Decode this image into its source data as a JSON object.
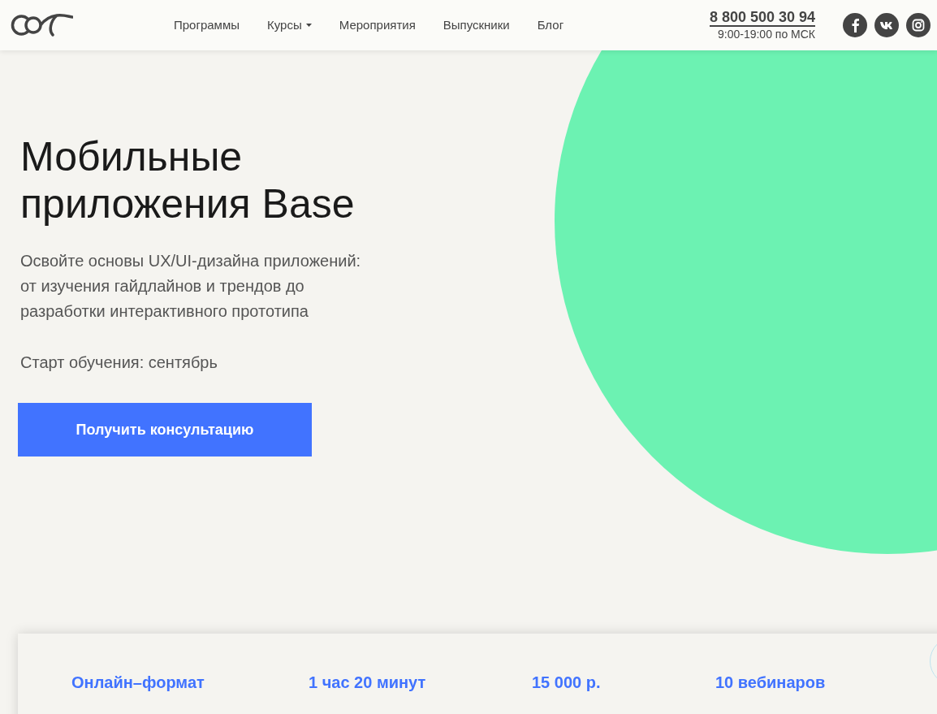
{
  "header": {
    "nav": [
      {
        "label": "Программы",
        "dropdown": false
      },
      {
        "label": "Курсы",
        "dropdown": true
      },
      {
        "label": "Мероприятия",
        "dropdown": false
      },
      {
        "label": "Выпускники",
        "dropdown": false
      },
      {
        "label": "Блог",
        "dropdown": false
      }
    ],
    "phone": "8 800 500 30 94",
    "hours": "9:00-19:00 по МСК",
    "social": [
      {
        "kind": "facebook"
      },
      {
        "kind": "vk"
      },
      {
        "kind": "instagram"
      }
    ]
  },
  "hero": {
    "title": "Мобильные приложения Base",
    "lines": [
      "Освойте основы UX/UI-дизайна приложений:",
      "от изучения гайдлайнов и трендов до",
      "разработки интерактивного прототипа"
    ],
    "start": "Старт обучения: сентябрь",
    "button": "Получить консультацию"
  },
  "facts": [
    "Онлайн–формат",
    "1 час 20 минут",
    "15 000 р.",
    "10 вебинаров"
  ]
}
